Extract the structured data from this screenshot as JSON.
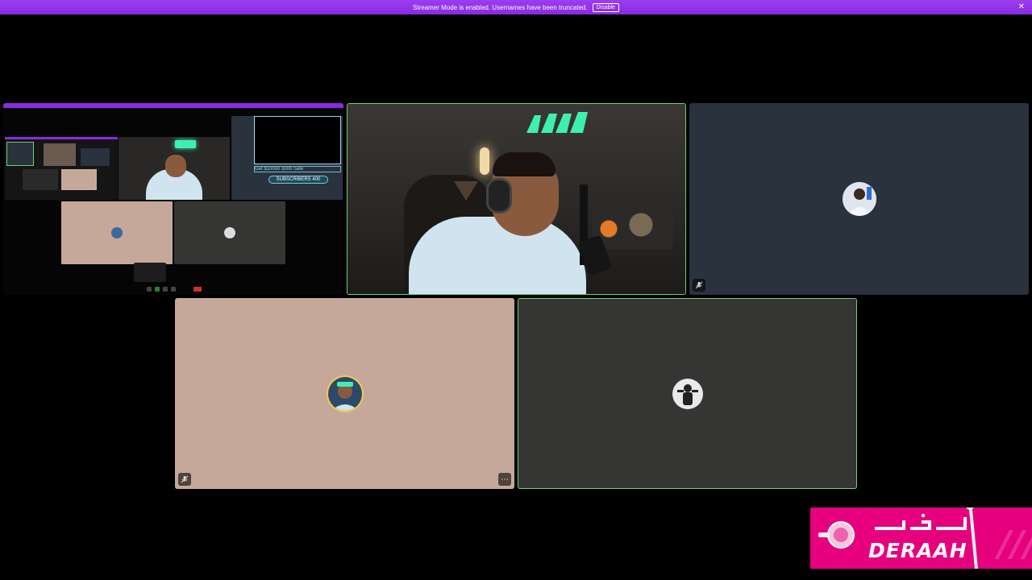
{
  "banner": {
    "message": "Streamer Mode is enabled. Usernames have been truncated.",
    "disable_label": "Disable",
    "close_glyph": "✕",
    "color": "#8a2be2"
  },
  "grid": {
    "screen_share": {
      "icon": "screen-share-preview"
    },
    "main_stream": {
      "state": "speaking",
      "border_color": "#6fd06f"
    },
    "participant_right": {
      "status_icon": "mic-muted-icon"
    },
    "participant_bottom_left": {
      "status_icon": "mic-muted-icon",
      "more_glyph": "⋯"
    },
    "participant_bottom_right": {
      "state": "speaking",
      "border_color": "#6fd06f"
    }
  },
  "share_preview": {
    "overlay_text": "SUBSCRIBERS 400",
    "ticker_text": "Get $10000 3000 Sale"
  },
  "overlay_logo": {
    "text_en": "DERAAH",
    "background": "#e6007e"
  }
}
